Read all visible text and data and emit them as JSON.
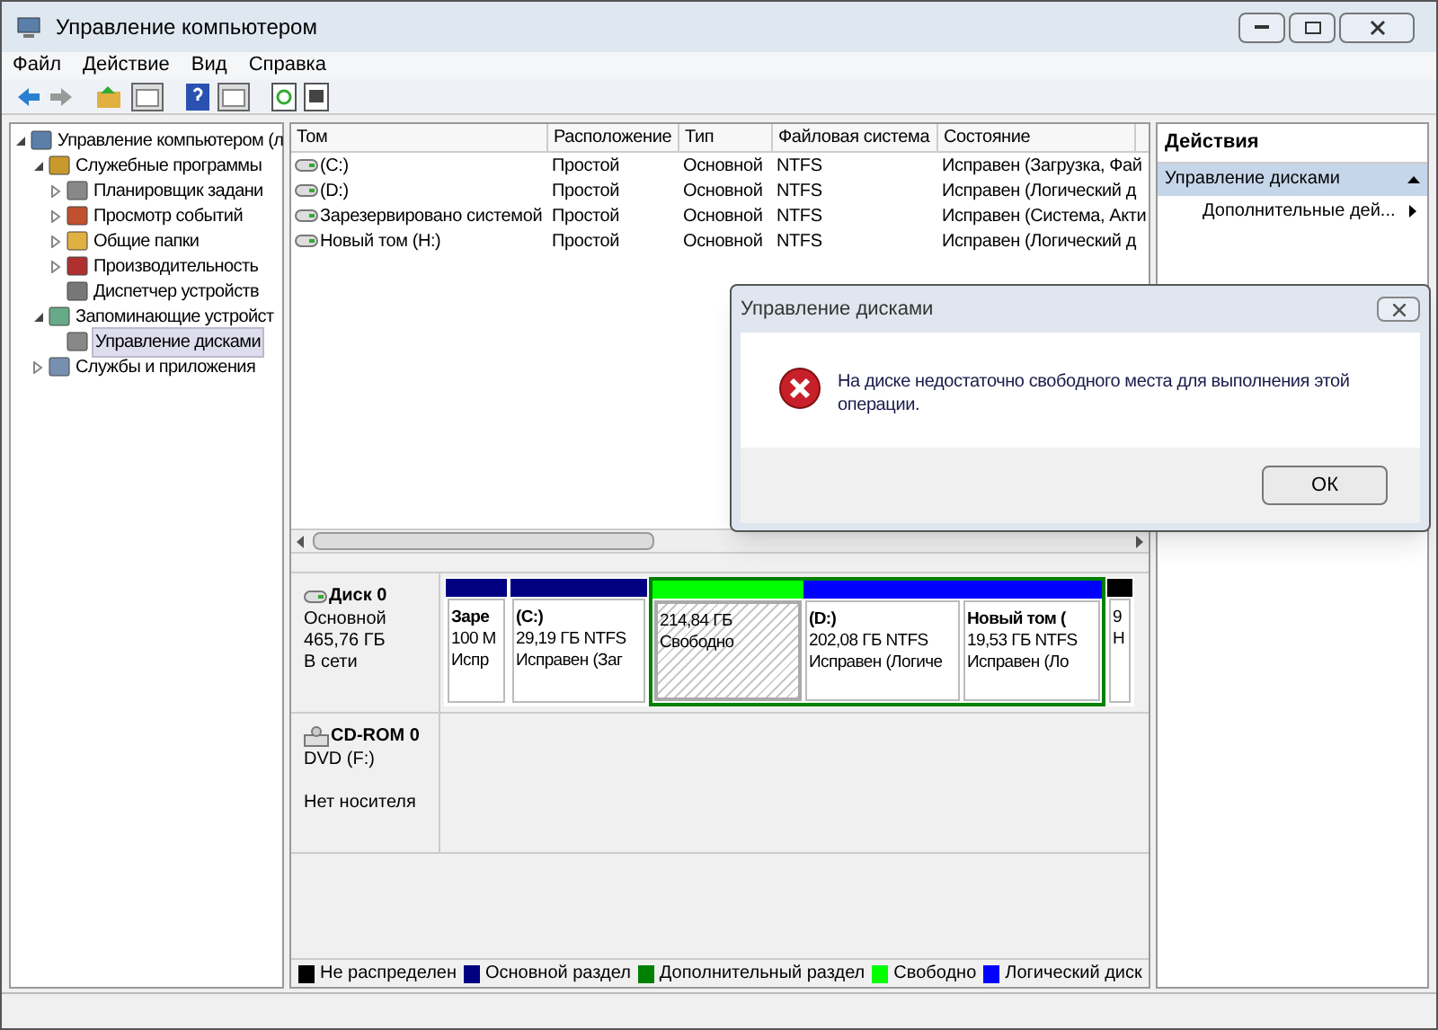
{
  "window": {
    "title": "Управление компьютером"
  },
  "menu": [
    "Файл",
    "Действие",
    "Вид",
    "Справка"
  ],
  "tree": [
    {
      "label": "Управление компьютером (л",
      "selected": false,
      "expanded": true,
      "children": [
        {
          "label": "Служебные программы",
          "selected": false,
          "expanded": true,
          "children": [
            {
              "label": "Планировщик задани",
              "selected": false,
              "expanded": false
            },
            {
              "label": "Просмотр событий",
              "selected": false,
              "expanded": false
            },
            {
              "label": "Общие папки",
              "selected": false,
              "expanded": false
            },
            {
              "label": "Производительность",
              "selected": false,
              "expanded": false
            },
            {
              "label": "Диспетчер устройств",
              "selected": false
            }
          ]
        },
        {
          "label": "Запоминающие устройст",
          "selected": false,
          "expanded": true,
          "children": [
            {
              "label": "Управление дисками",
              "selected": true
            }
          ]
        },
        {
          "label": "Службы и приложения",
          "selected": false,
          "expanded": false
        }
      ]
    }
  ],
  "table": {
    "columns": [
      "Том",
      "Расположение",
      "Тип",
      "Файловая система",
      "Состояние"
    ],
    "rows": [
      [
        "(C:)",
        "Простой",
        "Основной",
        "NTFS",
        "Исправен (Загрузка, Фай"
      ],
      [
        "(D:)",
        "Простой",
        "Основной",
        "NTFS",
        "Исправен (Логический д"
      ],
      [
        "Зарезервировано системой",
        "Простой",
        "Основной",
        "NTFS",
        "Исправен (Система, Акти"
      ],
      [
        "Новый том (H:)",
        "Простой",
        "Основной",
        "NTFS",
        "Исправен (Логический д"
      ]
    ]
  },
  "disks": [
    {
      "kind": "disk",
      "name": "Диск 0",
      "lines": [
        "Основной",
        "465,76 ГБ",
        "В сети"
      ],
      "partitions": [
        {
          "color": "#000080",
          "lines": [
            "Заре",
            "100 М",
            "Испр"
          ],
          "hatched": false,
          "extended": false
        },
        {
          "color": "#000080",
          "lines": [
            "(C:)",
            "29,19 ГБ NTFS",
            "Исправен (Заг"
          ],
          "hatched": false,
          "extended": false
        },
        {
          "color": "#00ff00",
          "lines": [
            "214,84 ГБ",
            "Свободно"
          ],
          "hatched": true,
          "extended": true
        },
        {
          "color": "#0000ff",
          "lines": [
            "(D:)",
            "202,08 ГБ NTFS",
            "Исправен (Логиче"
          ],
          "hatched": false,
          "extended": true
        },
        {
          "color": "#0000ff",
          "lines": [
            "Новый том (",
            "19,53 ГБ NTFS",
            "Исправен (Ло"
          ],
          "hatched": false,
          "extended": true
        },
        {
          "color": "#000000",
          "lines": [
            "9",
            "Н"
          ],
          "hatched": false,
          "extended": false
        }
      ]
    },
    {
      "kind": "cdrom",
      "name": "CD-ROM 0",
      "lines": [
        "DVD (F:)",
        "Нет носителя"
      ]
    }
  ],
  "legend": [
    {
      "label": "Не распределен",
      "color": "#000000"
    },
    {
      "label": "Основной раздел",
      "color": "#000080"
    },
    {
      "label": "Дополнительный раздел",
      "color": "#008000"
    },
    {
      "label": "Свободно",
      "color": "#00ff00"
    },
    {
      "label": "Логический диск",
      "color": "#0000ff"
    }
  ],
  "actions": {
    "title": "Действия",
    "section": "Управление дисками",
    "items": [
      "Дополнительные дей..."
    ]
  },
  "dialog": {
    "title": "Управление дисками",
    "message": "На диске недостаточно свободного места для выполнения этой операции.",
    "buttons": [
      "ОК"
    ]
  }
}
